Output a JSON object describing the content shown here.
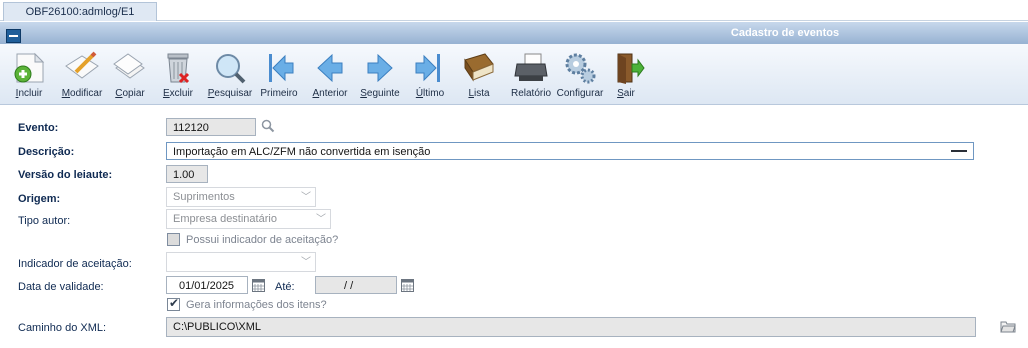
{
  "tab": {
    "label": "OBF26100:admlog/E1"
  },
  "window": {
    "title": "Cadastro de eventos"
  },
  "toolbar": {
    "buttons": [
      {
        "label": "Incluir",
        "icon": "add-document-icon"
      },
      {
        "label": "Modificar",
        "icon": "edit-document-icon"
      },
      {
        "label": "Copiar",
        "icon": "copy-document-icon"
      },
      {
        "label": "Excluir",
        "icon": "trash-icon"
      },
      {
        "label": "Pesquisar",
        "icon": "magnifier-icon"
      },
      {
        "label": "Primeiro",
        "icon": "first-arrow-icon"
      },
      {
        "label": "Anterior",
        "icon": "previous-arrow-icon"
      },
      {
        "label": "Seguinte",
        "icon": "next-arrow-icon"
      },
      {
        "label": "Último",
        "icon": "last-arrow-icon"
      },
      {
        "label": "Lista",
        "icon": "book-icon"
      },
      {
        "label": "Relatório",
        "icon": "printer-icon"
      },
      {
        "label": "Configurar",
        "icon": "gears-icon"
      },
      {
        "label": "Sair",
        "icon": "exit-door-icon"
      }
    ]
  },
  "form": {
    "evento": {
      "label": "Evento:",
      "value": "112120"
    },
    "descricao": {
      "label": "Descrição:",
      "value": "Importação em ALC/ZFM não convertida em isenção"
    },
    "versao": {
      "label": "Versão do leiaute:",
      "value": "1.00"
    },
    "origem": {
      "label": "Origem:",
      "value": "Suprimentos"
    },
    "tipo_autor": {
      "label": "Tipo autor:",
      "value": "Empresa destinatário"
    },
    "possui_indicador": {
      "label": "Possui indicador de aceitação?",
      "checked": false
    },
    "indicador_aceitacao": {
      "label": "Indicador de aceitação:",
      "value": ""
    },
    "data_validade": {
      "label": "Data de validade:",
      "value": "01/01/2025"
    },
    "ate": {
      "label": "Até:",
      "value": "/ /"
    },
    "gera_info": {
      "label": "Gera informações dos itens?",
      "checked": true
    },
    "caminho_xml": {
      "label": "Caminho do XML:",
      "value": "C:\\PUBLICO\\XML"
    }
  },
  "colors": {
    "titlebar": "#97b2d2",
    "accent": "#1f5e9a",
    "title_text": "#ffffff"
  }
}
